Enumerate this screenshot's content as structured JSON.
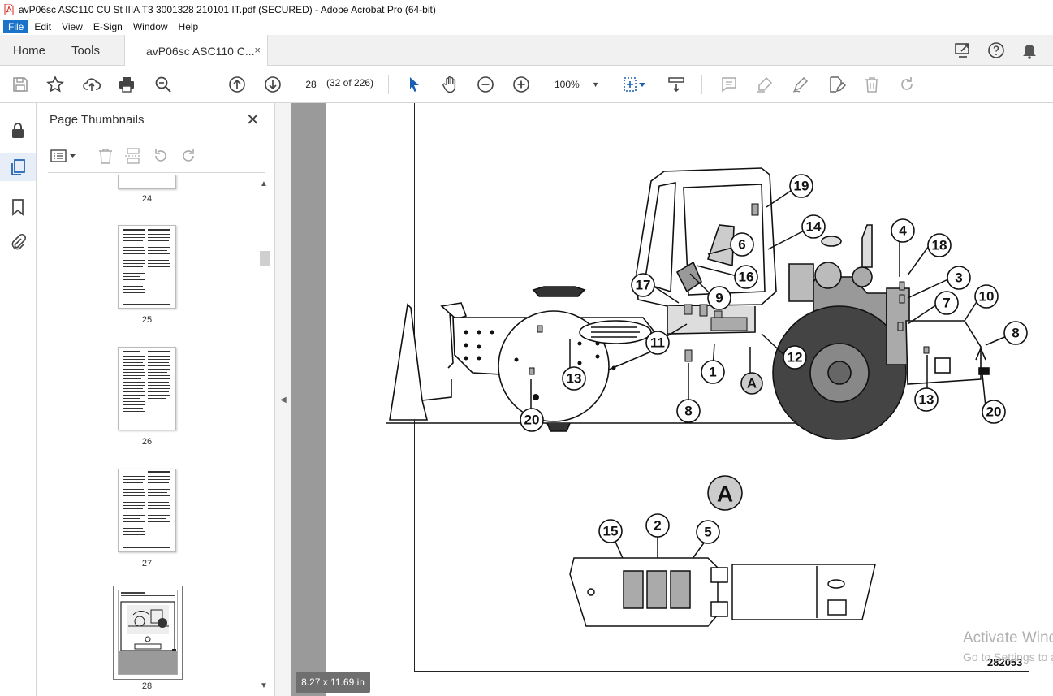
{
  "window": {
    "title": "avP06sc ASC110 CU St IIIA T3 3001328 210101 IT.pdf (SECURED) - Adobe Acrobat Pro (64-bit)"
  },
  "menu": {
    "items": [
      "File",
      "Edit",
      "View",
      "E-Sign",
      "Window",
      "Help"
    ]
  },
  "tabs": {
    "home": "Home",
    "tools": "Tools",
    "document": "avP06sc ASC110 C...",
    "close": "×"
  },
  "toolbar": {
    "page_number": "28",
    "page_count": "(32 of 226)",
    "zoom": "100%"
  },
  "thumbnails_panel": {
    "title": "Page Thumbnails",
    "close": "✕",
    "pages": [
      "24",
      "25",
      "26",
      "27",
      "28"
    ],
    "selected_page": "28"
  },
  "document": {
    "figure_number": "282053",
    "detail_label": "A",
    "callouts_main": [
      "19",
      "14",
      "6",
      "16",
      "9",
      "17",
      "4",
      "18",
      "3",
      "7",
      "10",
      "8",
      "11",
      "12",
      "1",
      "A",
      "13",
      "13",
      "20",
      "8",
      "20"
    ],
    "callouts_detail": [
      "15",
      "2",
      "5"
    ],
    "page_size": "8.27 x 11.69 in"
  },
  "watermark": {
    "line1": "Activate Windows",
    "line2": "Go to Settings to activa"
  },
  "colors": {
    "accent": "#1a73c8",
    "pdf_red": "#d7261e"
  }
}
